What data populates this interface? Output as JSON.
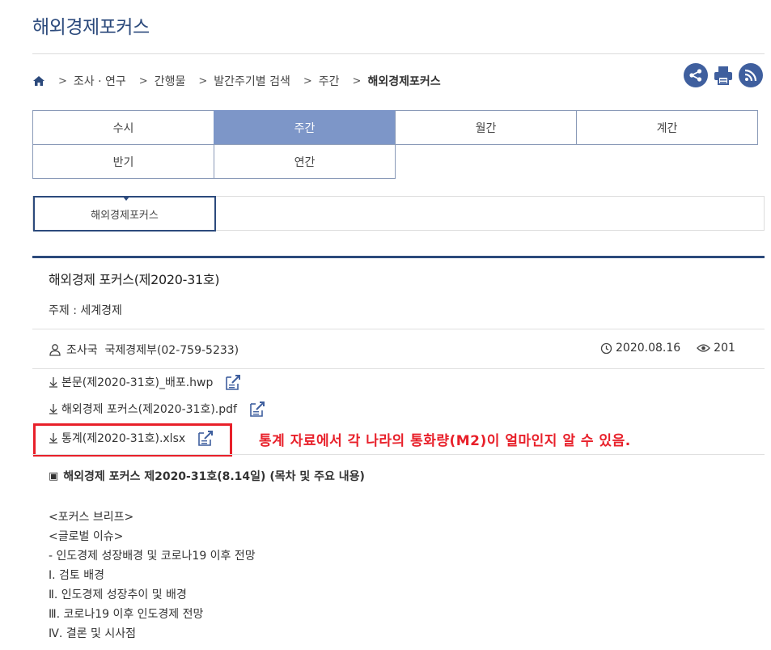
{
  "page_title": "해외경제포커스",
  "breadcrumb": {
    "items": [
      "조사 · 연구",
      "간행물",
      "발간주기별 검색",
      "주간",
      "해외경제포커스"
    ]
  },
  "tools": {
    "share_icon": "share-icon",
    "print_icon": "print-icon",
    "rss_icon": "rss-icon",
    "color": "#3f5f9e"
  },
  "period_tabs": {
    "row1": [
      "수시",
      "주간",
      "월간",
      "계간"
    ],
    "row2": [
      "반기",
      "연간"
    ],
    "active": "주간"
  },
  "sub_tab": {
    "label": "해외경제포커스"
  },
  "article": {
    "title": "해외경제 포커스(제2020-31호)",
    "subject": "주제 : 세계경제",
    "author": "조사국  국제경제부(02-759-5233)",
    "date": "2020.08.16",
    "views": "201"
  },
  "files": [
    {
      "name": "본문(제2020-31호)_배포.hwp"
    },
    {
      "name": "해외경제 포커스(제2020-31호).pdf"
    },
    {
      "name": "통계(제2020-31호).xlsx"
    }
  ],
  "annotation": {
    "text": "통계 자료에서 각 나라의 통화량(M2)이 얼마인지 알 수 있음.",
    "color": "#e8202a"
  },
  "toc": {
    "marker": "▣",
    "heading": "해외경제 포커스 제2020-31호(8.14일) (목차 및 주요 내용)",
    "lines": [
      "<포커스 브리프>",
      "<글로벌 이슈>",
      "- 인도경제 성장배경 및 코로나19 이후 전망",
      "Ⅰ. 검토 배경",
      "Ⅱ. 인도경제 성장추이 및 배경",
      "Ⅲ. 코로나19 이후 인도경제 전망",
      "Ⅳ. 결론 및 시사점"
    ]
  },
  "colors": {
    "brand": "#2c4a7c",
    "active_tab": "#7d96c8"
  }
}
